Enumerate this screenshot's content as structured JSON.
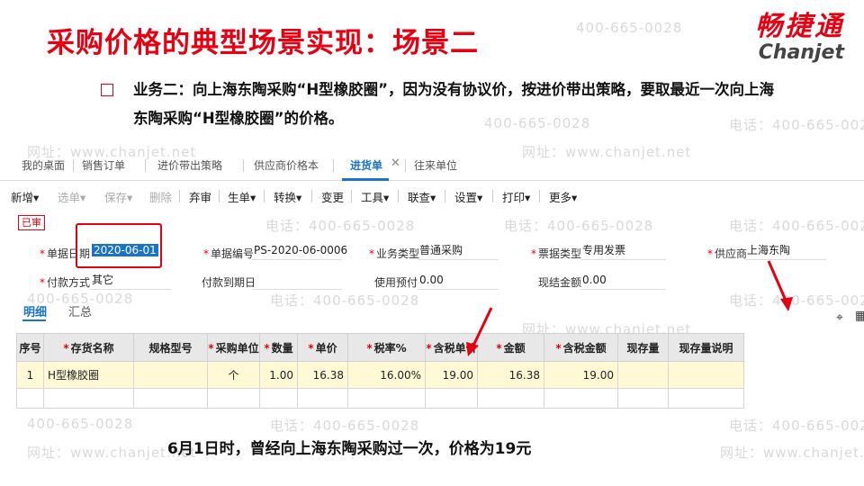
{
  "slide": {
    "title": "采购价格的典型场景实现：场景二",
    "description": "业务二：向上海东陶采购“H型橡胶圈”，因为没有协议价，按进价带出策略，要取最近一次向上海东陶采购“H型橡胶圈”的价格。",
    "caption": "6月1日时，曾经向上海东陶采购过一次，价格为19元"
  },
  "logo": {
    "cn": "畅捷通",
    "en": "Chanjet"
  },
  "watermarks": {
    "phone": "电话：400-665-0028",
    "site": "网址：www.chanjet.net",
    "number": "400-665-0028"
  },
  "tabs": [
    {
      "label": "我的桌面"
    },
    {
      "label": "销售订单"
    },
    {
      "label": "进价带出策略"
    },
    {
      "label": "供应商价格本"
    },
    {
      "label": "进货单"
    },
    {
      "label": "往来单位"
    }
  ],
  "toolbar": [
    {
      "label": "新增",
      "icon": "caret-down-icon"
    },
    {
      "label": "选单",
      "icon": "caret-down-icon"
    },
    {
      "label": "保存",
      "icon": "caret-down-icon"
    },
    {
      "label": "删除"
    },
    {
      "label": "弃审"
    },
    {
      "label": "生单",
      "icon": "caret-down-icon"
    },
    {
      "label": "转换",
      "icon": "caret-down-icon"
    },
    {
      "label": "变更"
    },
    {
      "label": "工具",
      "icon": "caret-down-icon"
    },
    {
      "label": "联查",
      "icon": "caret-down-icon"
    },
    {
      "label": "设置",
      "icon": "caret-down-icon"
    },
    {
      "label": "打印",
      "icon": "caret-down-icon"
    },
    {
      "label": "更多",
      "icon": "caret-down-icon"
    }
  ],
  "status": "已审",
  "form": {
    "doc_date_label": "单据日期",
    "doc_date": "2020-06-01",
    "doc_no_label": "单据编号",
    "doc_no": "PS-2020-06-0006",
    "biz_type_label": "业务类型",
    "biz_type": "普通采购",
    "invoice_type_label": "票据类型",
    "invoice_type": "专用发票",
    "supplier_label": "供应商",
    "supplier": "上海东陶",
    "pay_method_label": "付款方式",
    "pay_method": "其它",
    "due_date_label": "付款到期日",
    "due_date": "",
    "prepay_label": "使用预付",
    "prepay": "0.00",
    "cash_label": "现结金额",
    "cash": "0.00"
  },
  "subtabs": [
    {
      "label": "明细"
    },
    {
      "label": "汇总"
    }
  ],
  "grid": {
    "headers": [
      "序号",
      "存货名称",
      "规格型号",
      "采购单位",
      "数量",
      "单价",
      "税率%",
      "含税单价",
      "金额",
      "含税金额",
      "现存量",
      "现存量说明"
    ],
    "required": [
      false,
      true,
      false,
      true,
      true,
      true,
      true,
      true,
      true,
      true,
      false,
      false
    ],
    "rows": [
      [
        "1",
        "H型橡胶圈",
        "",
        "个",
        "1.00",
        "16.38",
        "16.00%",
        "19.00",
        "16.38",
        "19.00",
        "",
        ""
      ]
    ]
  },
  "colors": {
    "accent_red": "#e60012",
    "link_blue": "#1a73c7",
    "selected_row": "#fff9d6"
  }
}
